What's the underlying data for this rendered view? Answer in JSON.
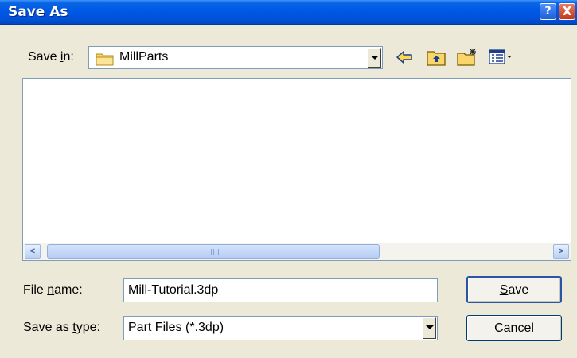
{
  "window": {
    "title": "Save As",
    "help_glyph": "?",
    "close_glyph": "X"
  },
  "save_in": {
    "label_prefix": "Save ",
    "label_access": "i",
    "label_suffix": "n:",
    "value": "MillParts",
    "folder_icon": "folder-icon"
  },
  "toolbar": {
    "icons": [
      "back-arrow-icon",
      "up-one-level-icon",
      "new-folder-icon",
      "views-menu-icon"
    ]
  },
  "file_list": {
    "items": []
  },
  "file_name": {
    "label_prefix": "File ",
    "label_access": "n",
    "label_suffix": "ame:",
    "value": "Mill-Tutorial.3dp"
  },
  "save_as_type": {
    "label_prefix": "Save as ",
    "label_access": "t",
    "label_suffix": "ype:",
    "value": "Part Files (*.3dp)"
  },
  "buttons": {
    "save_access": "S",
    "save_rest": "ave",
    "cancel": "Cancel"
  },
  "colors": {
    "title_bar": "#0058e6",
    "dialog_bg": "#ece9d8",
    "border": "#7f9db9"
  }
}
